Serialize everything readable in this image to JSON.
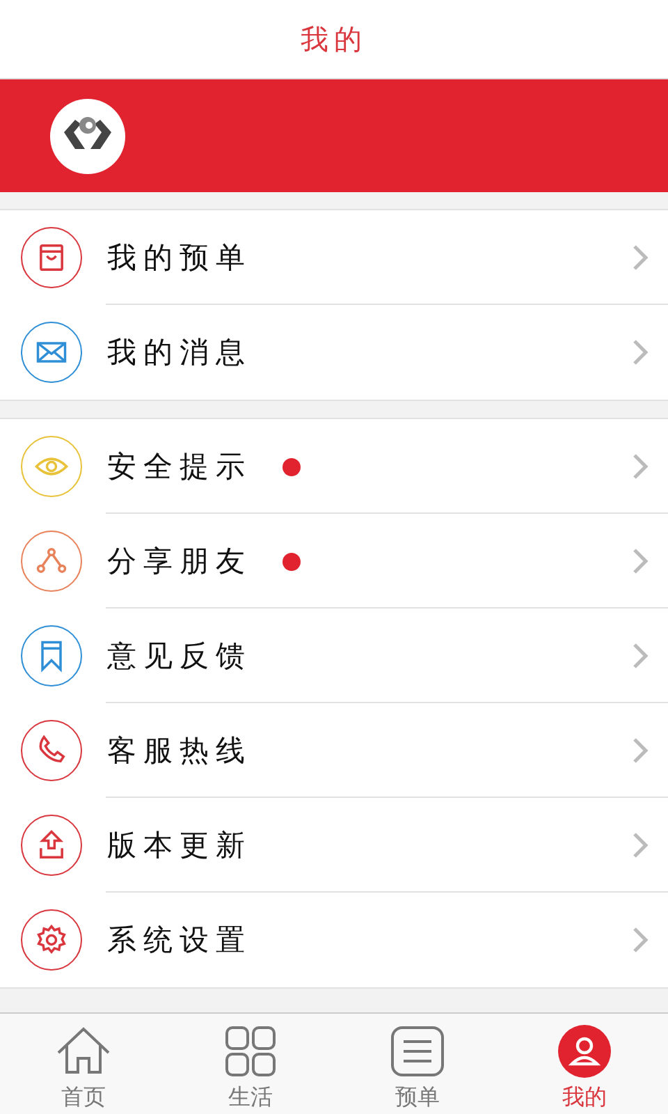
{
  "header": {
    "title": "我的"
  },
  "groups": [
    {
      "items": [
        {
          "kind": "bag",
          "label": "我的预单",
          "color": "#d9363e",
          "dot": false
        },
        {
          "kind": "mail",
          "label": "我的消息",
          "color": "#2f8fd6",
          "dot": false
        }
      ]
    },
    {
      "items": [
        {
          "kind": "eye",
          "label": "安全提示",
          "color": "#e8c239",
          "dot": true
        },
        {
          "kind": "share",
          "label": "分享朋友",
          "color": "#e8825a",
          "dot": true
        },
        {
          "kind": "bookmark",
          "label": "意见反馈",
          "color": "#2f8fd6",
          "dot": false
        },
        {
          "kind": "phone",
          "label": "客服热线",
          "color": "#d9363e",
          "dot": false
        },
        {
          "kind": "upload",
          "label": "版本更新",
          "color": "#d9363e",
          "dot": false
        },
        {
          "kind": "gear",
          "label": "系统设置",
          "color": "#d9363e",
          "dot": false
        }
      ]
    }
  ],
  "tabs": [
    {
      "kind": "home",
      "label": "首页",
      "selected": false
    },
    {
      "kind": "grid",
      "label": "生活",
      "selected": false
    },
    {
      "kind": "list",
      "label": "预单",
      "selected": false
    },
    {
      "kind": "user",
      "label": "我的",
      "selected": true
    }
  ]
}
